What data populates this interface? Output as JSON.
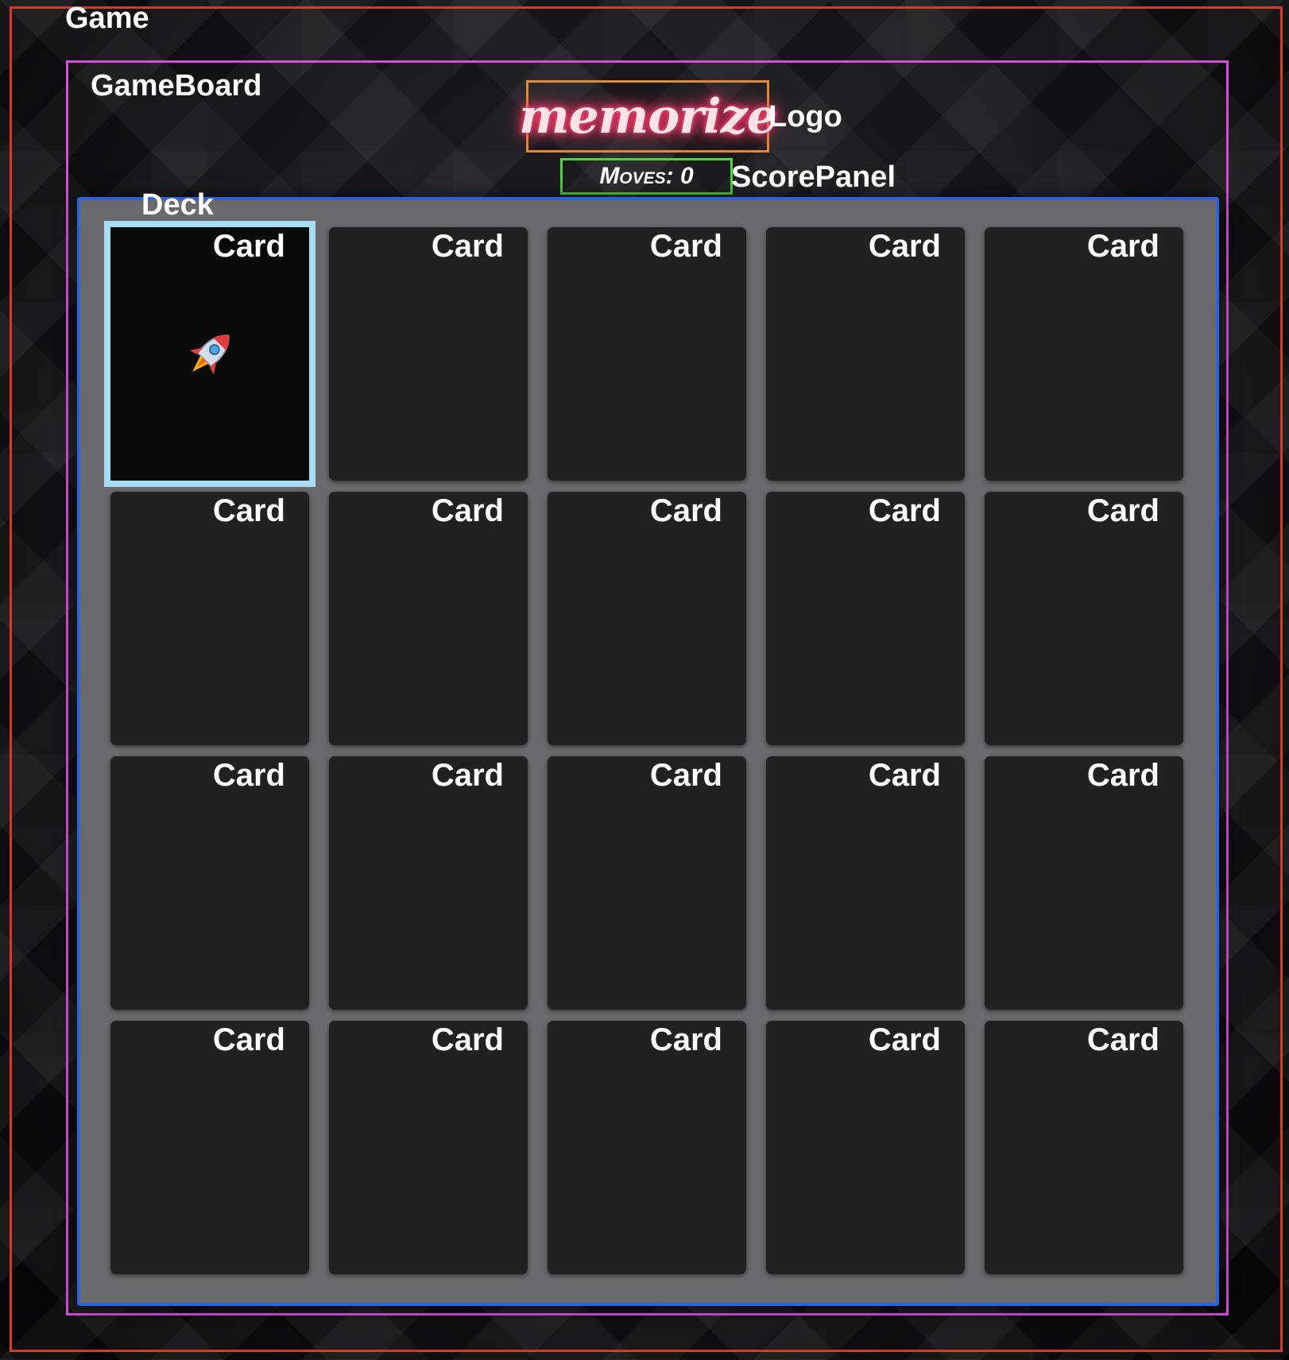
{
  "annotations": {
    "game": "Game",
    "game_board": "GameBoard",
    "logo": "Logo",
    "score_panel": "ScorePanel",
    "deck": "Deck"
  },
  "logo": {
    "text": "memorize"
  },
  "score_panel": {
    "moves_text": "Moves: 0"
  },
  "deck": {
    "rows": 4,
    "columns": 5,
    "cards": [
      {
        "label": "Card",
        "state": "flipped",
        "face_icon": "rocket-icon"
      },
      {
        "label": "Card",
        "state": "face-down"
      },
      {
        "label": "Card",
        "state": "face-down"
      },
      {
        "label": "Card",
        "state": "face-down"
      },
      {
        "label": "Card",
        "state": "face-down"
      },
      {
        "label": "Card",
        "state": "face-down"
      },
      {
        "label": "Card",
        "state": "face-down"
      },
      {
        "label": "Card",
        "state": "face-down"
      },
      {
        "label": "Card",
        "state": "face-down"
      },
      {
        "label": "Card",
        "state": "face-down"
      },
      {
        "label": "Card",
        "state": "face-down"
      },
      {
        "label": "Card",
        "state": "face-down"
      },
      {
        "label": "Card",
        "state": "face-down"
      },
      {
        "label": "Card",
        "state": "face-down"
      },
      {
        "label": "Card",
        "state": "face-down"
      },
      {
        "label": "Card",
        "state": "face-down"
      },
      {
        "label": "Card",
        "state": "face-down"
      },
      {
        "label": "Card",
        "state": "face-down"
      },
      {
        "label": "Card",
        "state": "face-down"
      },
      {
        "label": "Card",
        "state": "face-down"
      }
    ]
  },
  "colors": {
    "game_outline": "#d8392b",
    "board_outline": "#d44ddc",
    "logo_outline": "#e58a36",
    "score_outline": "#4fd43f",
    "deck_outline": "#2d63e0",
    "selected_card_outline": "#a7dcf6",
    "card_back": "#212121",
    "deck_background": "#6a6a6c",
    "logo_glow": "#ff3b6e"
  }
}
